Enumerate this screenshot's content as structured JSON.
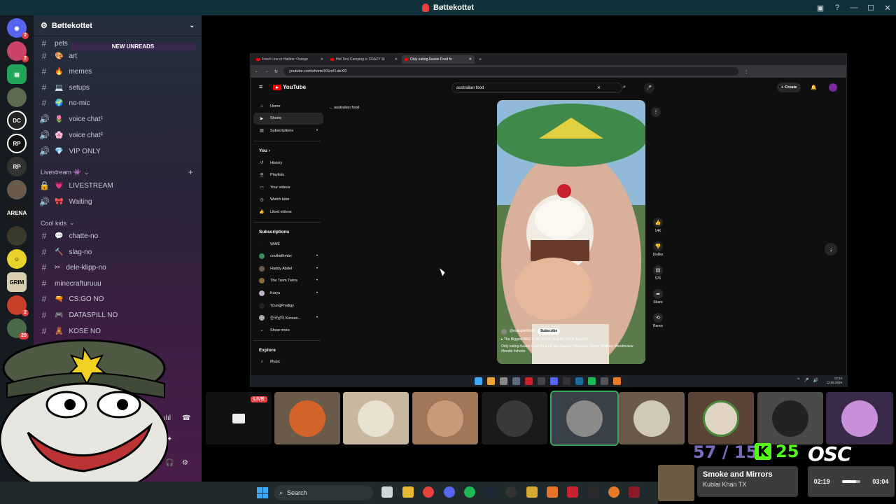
{
  "window": {
    "title": "Bøttekottet"
  },
  "guild_badges": [
    "2",
    "2",
    "2",
    "29"
  ],
  "server": {
    "name": "Bøttekottet",
    "new_unreads": "NEW UNREADS"
  },
  "channels": [
    {
      "name": "pets",
      "type": "text",
      "emoji": ""
    },
    {
      "name": "art",
      "type": "text",
      "emoji": "🎨"
    },
    {
      "name": "memes",
      "type": "text",
      "emoji": "🔥"
    },
    {
      "name": "setups",
      "type": "text",
      "emoji": "💻"
    },
    {
      "name": "no-mic",
      "type": "text",
      "emoji": "🌍"
    },
    {
      "name": "voice chat¹",
      "type": "voice",
      "emoji": "🌷"
    },
    {
      "name": "voice chat²",
      "type": "voice",
      "emoji": "🌸"
    },
    {
      "name": "VIP ONLY",
      "type": "voice",
      "emoji": "💎"
    }
  ],
  "category_livestream": "Livestream 👾",
  "livestream_channels": [
    {
      "name": "LIVESTREAM",
      "emoji": "💗"
    },
    {
      "name": "Waiting",
      "emoji": "🎀"
    }
  ],
  "category_cool_kids": "Cool kids",
  "cool_kids_channels": [
    {
      "name": "chatte-no",
      "emoji": "💬"
    },
    {
      "name": "slag-no",
      "emoji": "🔨"
    },
    {
      "name": "dele-klipp-no",
      "emoji": "✂"
    },
    {
      "name": "minecrafturuuu",
      "emoji": ""
    },
    {
      "name": "CS:GO NO",
      "emoji": "🔫"
    },
    {
      "name": "DATASPILL NO",
      "emoji": "🎮"
    },
    {
      "name": "KOSE NO",
      "emoji": "🧸"
    }
  ],
  "browser": {
    "tabs": [
      "Fresh Line or Hatline: Orange",
      "Hot Tent Camping in CRAZY St",
      "Only eating Aussie Food fo"
    ],
    "url": "youtube.com/shorts/XSzvFi.deXR"
  },
  "youtube": {
    "logo": "YouTube",
    "search_query": "australian food",
    "create_label": "Create",
    "back_label": "australian food",
    "nav": [
      "Home",
      "Shorts",
      "Subscriptions"
    ],
    "you_label": "You",
    "you_items": [
      "History",
      "Playlists",
      "Your videos",
      "Watch later",
      "Liked videos"
    ],
    "subscriptions_label": "Subscriptions",
    "subscriptions": [
      "WWE",
      "coolkidfrmbx",
      "Haddy Abdel",
      "The Trem Twins",
      "Karyu",
      "YoungProdigy",
      "한국남자 Korean...",
      "Show more"
    ],
    "explore_label": "Explore",
    "explore_items": [
      "Music"
    ]
  },
  "short": {
    "channel": "@eatingwithbod",
    "subscribe": "Subscribe",
    "song": "The Biggest BBQ in the World (And It's Not in Texas?)",
    "description": "Only eating Aussie Food for a full day #aussie #australia #perth #sydney #foodreview #foodie #shorts",
    "likes": "14K",
    "dislike": "Dislike",
    "comments": "576",
    "share": "Share",
    "remix": "Remix"
  },
  "inner_clock": {
    "time": "12:24",
    "date": "12.08.2025"
  },
  "live_badge": "LIVE",
  "stats": {
    "counts": "57 / 15",
    "kick": "25",
    "logo": "OSC"
  },
  "now_playing": {
    "title": "Smoke and Mirrors",
    "artist": "Kublai Khan TX",
    "elapsed": "02:19",
    "duration": "03:04",
    "progress": 0.755
  },
  "taskbar": {
    "search_placeholder": "Search"
  }
}
